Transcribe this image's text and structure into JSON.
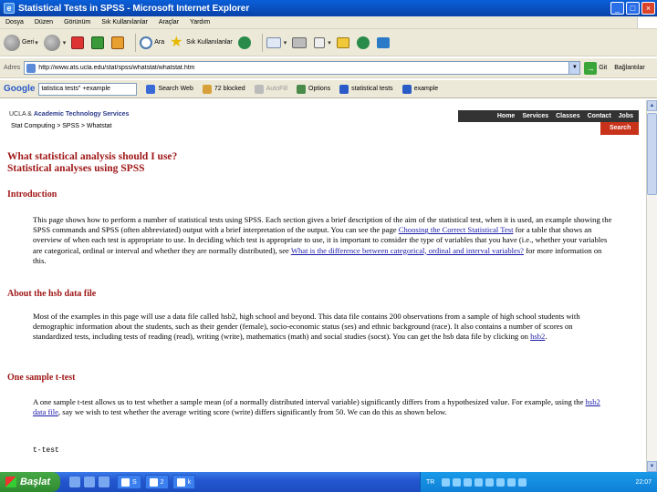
{
  "window": {
    "title": "Statistical Tests in SPSS - Microsoft Internet Explorer",
    "minimize": "_",
    "maximize": "□",
    "close": "×"
  },
  "menu": [
    "Dosya",
    "Düzen",
    "Görünüm",
    "Sık Kullanılanlar",
    "Araçlar",
    "Yardım"
  ],
  "toolbar": {
    "back_label": "Geri",
    "search_label": "Ara",
    "favorites_label": "Sık Kullanılanlar"
  },
  "address": {
    "label": "Adres",
    "url": "http://www.ats.ucla.edu/stat/spss/whatstat/whatstat.htm",
    "go_label": "Git",
    "links_label": "Bağlantılar"
  },
  "google": {
    "logo": "Google",
    "query": "tatistica tests\" +example",
    "buttons": [
      "Search Web",
      "72 blocked",
      "AutoFill",
      "Options",
      "statistical tests",
      "example"
    ]
  },
  "site": {
    "org": "UCLA",
    "org_sub": "Academic Technology Services",
    "breadcrumb": "Stat Computing > SPSS > Whatstat",
    "nav": [
      "Home",
      "Services",
      "Classes",
      "Contact",
      "Jobs"
    ],
    "search": "Search"
  },
  "page": {
    "title_line1": "What statistical analysis should I use?",
    "title_line2": "Statistical analyses using SPSS",
    "sections": [
      {
        "heading": "Introduction",
        "text_a": "This page shows how to perform a number of statistical tests using SPSS.  Each section gives a brief description of the aim of the statistical test, when it is used, an example showing the SPSS commands and SPSS (often abbreviated) output with a brief interpretation of the output. You can see the page ",
        "link1": "Choosing the Correct Statistical Test",
        "text_b": " for a table that shows an overview of when each test is appropriate to use.  In deciding which test is appropriate to use, it is important to consider the type of variables that you have (i.e., whether your variables are categorical, ordinal or interval and whether they are normally distributed), see ",
        "link2": "What is the difference between categorical, ordinal and interval variables?",
        "text_c": " for more information on this."
      },
      {
        "heading": "About the hsb data file",
        "text_a": "Most of the examples in this page will use a data file called hsb2, high school and beyond.  This data file contains 200 observations from a sample of high school students with demographic information about the students, such as their gender (female), socio-economic status (ses) and ethnic background (race). It also contains a number of scores on standardized tests, including tests of reading (read), writing (write), mathematics (math) and social studies (socst).  You can get the hsb data file by clicking on ",
        "link1": "hsb2",
        "text_b": "."
      },
      {
        "heading": "One sample t-test",
        "text_a": "A one sample t-test allows us to test whether a sample mean (of a normally distributed interval variable) significantly differs from a hypothesized value.  For example, using the ",
        "link1": "hsb2 data file",
        "text_b": ", say we wish to test whether the average writing score (write) differs significantly from 50.  We can do this as shown below."
      }
    ],
    "code": "t-test"
  },
  "taskbar": {
    "start": "Başlat",
    "tasks": [
      "S",
      "2",
      "k"
    ],
    "lang": "TR",
    "clock": "22:07"
  }
}
